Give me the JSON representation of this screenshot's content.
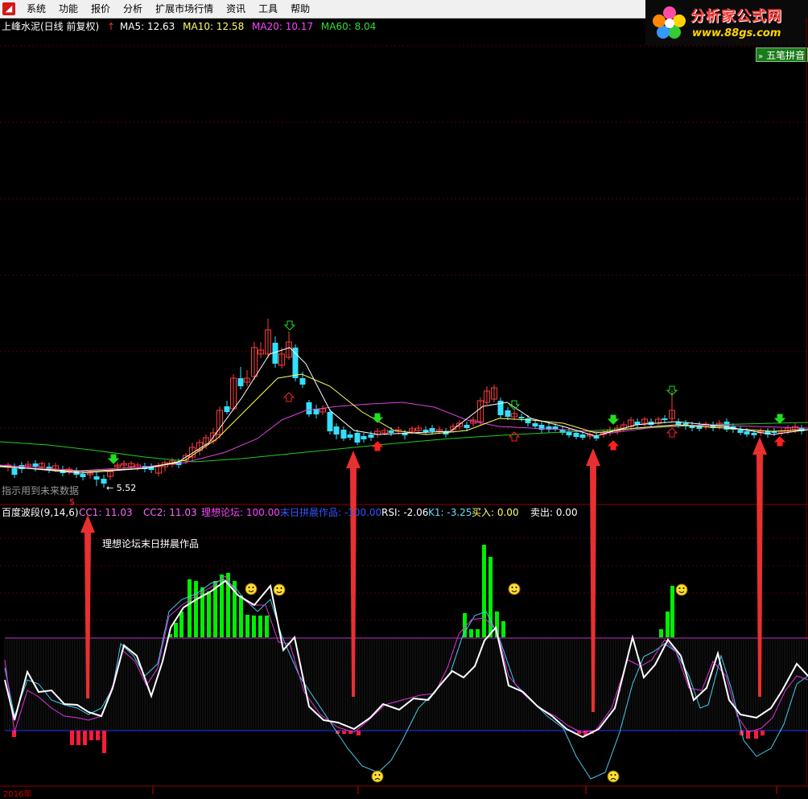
{
  "menu": {
    "items": [
      "系统",
      "功能",
      "报价",
      "分析",
      "扩展市场行情",
      "资讯",
      "工具",
      "帮助"
    ]
  },
  "logo": {
    "name": "分析家公式网",
    "url_text": "www.88gs.com"
  },
  "wubi_button": {
    "label": "五笔拼音"
  },
  "stock": {
    "name": "上峰水泥(日线 前复权)",
    "ma": [
      {
        "label": "MA5: 12.63",
        "color": "#ffffff"
      },
      {
        "label": "MA10: 12.58",
        "color": "#ffff66"
      },
      {
        "label": "MA20: 10.17",
        "color": "#ff44ff"
      },
      {
        "label": "MA60: 8.04",
        "color": "#33dd33"
      }
    ]
  },
  "notes": {
    "future_data": "指示用到未来数据",
    "author": "理想论坛末日拼晨作品",
    "low_price": "5.52",
    "year": "2016年"
  },
  "indicator": {
    "name": "百度波段(9,14,6)",
    "values": [
      {
        "label": "CC1: 11.03",
        "color": "#ff66ff"
      },
      {
        "label": "CC2: 11.03",
        "color": "#ff66ff"
      },
      {
        "label": "理想论坛: 100.00",
        "color": "#ff44ff"
      },
      {
        "label": "末日拼晨作品: -100.00",
        "color": "#3355ff"
      },
      {
        "label": "RSI: -2.06",
        "color": "#ffffff"
      },
      {
        "label": "K1: -3.25",
        "color": "#66ddff"
      },
      {
        "label": "买入: 0.00",
        "color": "#ffff66"
      },
      {
        "label": "卖出: 0.00",
        "color": "#ffffff"
      }
    ]
  },
  "colors": {
    "up": "#ff3c3c",
    "down": "#33e0ff",
    "ma5": "#ffffff",
    "ma10": "#ffff66",
    "ma20": "#dd44dd",
    "ma60": "#22cc22",
    "green_bar": "#00ee00",
    "red_bar": "#ff1a3a",
    "rsi_line": "#ffffff",
    "k1_line": "#44ccee",
    "cc_line": "#dd33dd",
    "arrow": "#e83030"
  }
}
